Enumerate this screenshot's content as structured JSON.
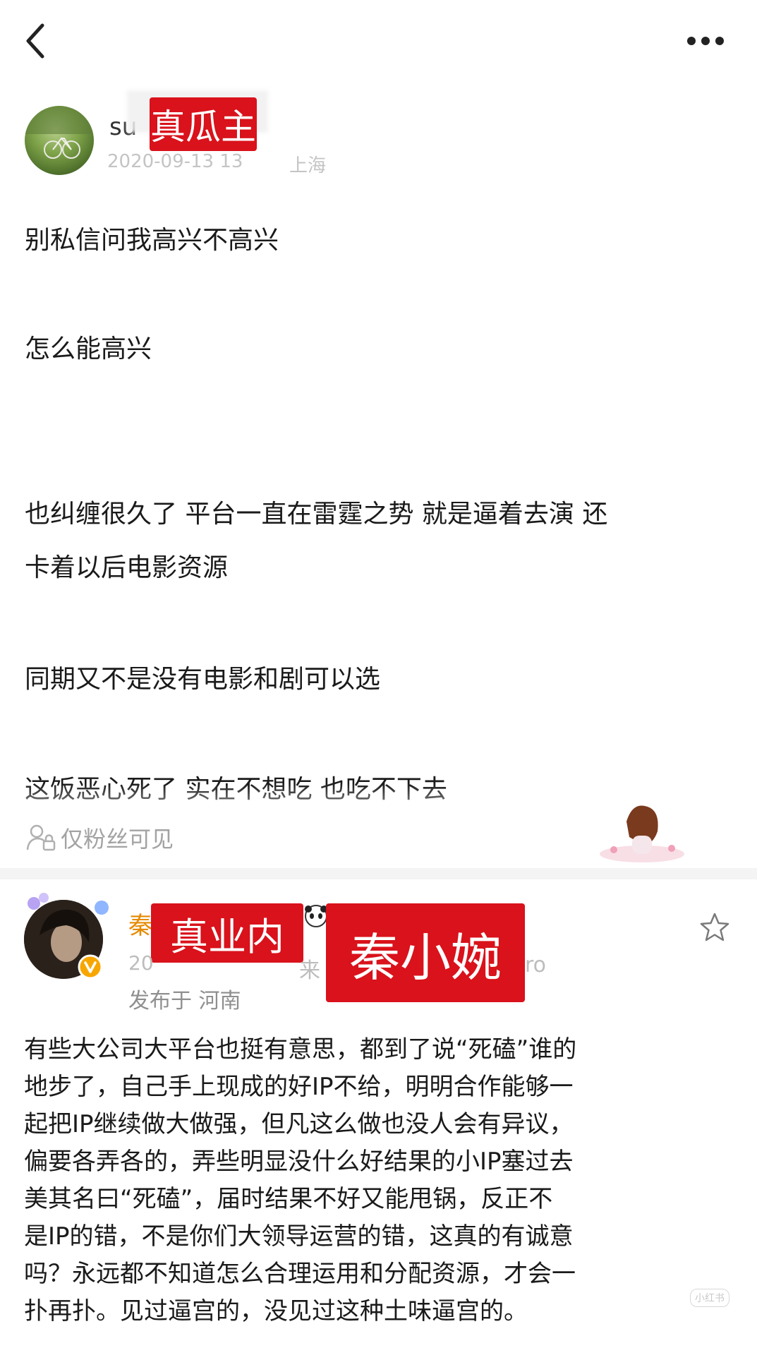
{
  "header": {
    "back_icon": "chevron-left-icon",
    "more_icon": "more-horizontal-icon"
  },
  "post1": {
    "username_partial": "su",
    "label": "真瓜主",
    "meta_partial": "2020-09-13 13",
    "meta_location": "上海",
    "paragraphs": [
      "别私信问我高兴不高兴",
      "怎么能高兴",
      "也纠缠很久了 平台一直在雷霆之势 就是逼着去演 还",
      "卡着以后电影资源",
      "同期又不是没有电影和剧可以选",
      "这饭恶心死了 实在不想吃 也吃不下去"
    ],
    "visibility_label": "仅粉丝可见",
    "visibility_icon": "lock-person-icon"
  },
  "post2": {
    "username_partial": "秦",
    "label_left": "真业内",
    "label_right": "秦小婉",
    "meta_partial": "20",
    "meta_source_partial": "来",
    "meta_device_partial": "ro",
    "location": "发布于 河南",
    "star_icon": "star-outline-icon",
    "verified_icon": "verified-v-icon",
    "lines": [
      "有些大公司大平台也挺有意思，都到了说“死磕”谁的",
      "地步了，自己手上现成的好IP不给，明明合作能够一",
      "起把IP继续做大做强，但凡这么做也没人会有异议，",
      "偏要各弄各的，弄些明显没什么好结果的小IP塞过去",
      "美其名曰“死磕”，届时结果不好又能甩锅，反正不",
      "是IP的错，不是你们大领导运营的错，这真的有诚意",
      "吗？永远都不知道怎么合理运用和分配资源，才会一",
      "扑再扑。见过逼宫的，没见过这种土味逼宫的。"
    ]
  },
  "watermark": "小红书"
}
